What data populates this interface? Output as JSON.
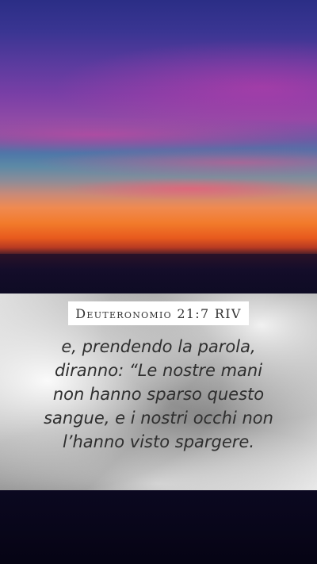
{
  "reference": "Deuteronomio 21:7 RIV",
  "verse_lines": [
    "e, prendendo la parola,",
    "diranno: “Le nostre mani",
    "non hanno sparso questo",
    "sangue, e i nostri occhi non",
    "l’hanno visto spargere."
  ],
  "colors": {
    "sky_top": "#2b2e86",
    "sky_magenta": "#8f4aa6",
    "sunset_orange": "#f27a2a",
    "panel_silver": "#9a9a9a",
    "badge_background": "#ffffff",
    "text": "#2e2e2e",
    "bottom_band": "#0b0820"
  }
}
